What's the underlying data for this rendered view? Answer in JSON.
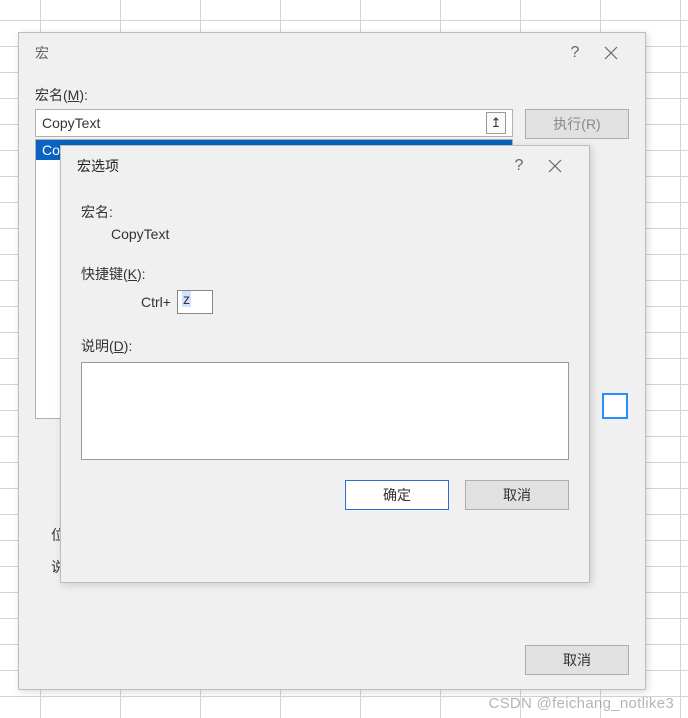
{
  "macro_dialog": {
    "title": "宏",
    "name_label_prefix": "宏名(",
    "name_label_hotkey": "M",
    "name_label_suffix": "):",
    "name_value": "CopyText",
    "list": {
      "selected": "CopyText"
    },
    "side": {
      "run_partial": "执行(R)"
    },
    "loc_label_trunc": "位",
    "desc_label_trunc": "说",
    "cancel": "取消"
  },
  "options_dialog": {
    "title": "宏选项",
    "name_label": "宏名:",
    "name_value": "CopyText",
    "shortcut_label_prefix": "快捷键(",
    "shortcut_label_hotkey": "K",
    "shortcut_label_suffix": "):",
    "shortcut_prefix": "Ctrl+",
    "shortcut_key": "z",
    "desc_label_prefix": "说明(",
    "desc_label_hotkey": "D",
    "desc_label_suffix": "):",
    "ok": "确定",
    "cancel": "取消"
  },
  "watermark": "CSDN @feichang_notlike3"
}
